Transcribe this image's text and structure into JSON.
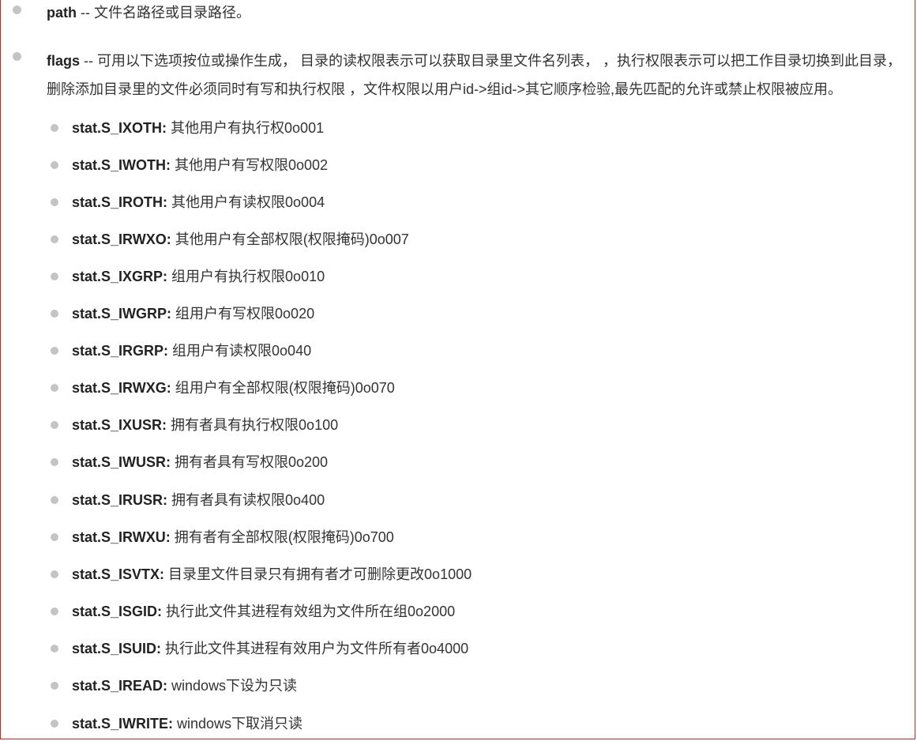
{
  "params": [
    {
      "name": "path",
      "separator": " -- ",
      "text": "文件名路径或目录路径。"
    },
    {
      "name": "flags",
      "separator": " -- ",
      "text": "可用以下选项按位或操作生成， 目录的读权限表示可以获取目录里文件名列表， ，执行权限表示可以把工作目录切换到此目录， 删除添加目录里的文件必须同时有写和执行权限 ，文件权限以用户id->组id->其它顺序检验,最先匹配的允许或禁止权限被应用。"
    }
  ],
  "flags": [
    {
      "name": "stat.S_IXOTH:",
      "desc": " 其他用户有执行权0o001"
    },
    {
      "name": "stat.S_IWOTH:",
      "desc": " 其他用户有写权限0o002"
    },
    {
      "name": "stat.S_IROTH:",
      "desc": " 其他用户有读权限0o004"
    },
    {
      "name": "stat.S_IRWXO:",
      "desc": " 其他用户有全部权限(权限掩码)0o007"
    },
    {
      "name": "stat.S_IXGRP:",
      "desc": " 组用户有执行权限0o010"
    },
    {
      "name": "stat.S_IWGRP:",
      "desc": " 组用户有写权限0o020"
    },
    {
      "name": "stat.S_IRGRP:",
      "desc": " 组用户有读权限0o040"
    },
    {
      "name": "stat.S_IRWXG:",
      "desc": " 组用户有全部权限(权限掩码)0o070"
    },
    {
      "name": "stat.S_IXUSR:",
      "desc": " 拥有者具有执行权限0o100"
    },
    {
      "name": "stat.S_IWUSR:",
      "desc": " 拥有者具有写权限0o200"
    },
    {
      "name": "stat.S_IRUSR:",
      "desc": " 拥有者具有读权限0o400"
    },
    {
      "name": "stat.S_IRWXU:",
      "desc": " 拥有者有全部权限(权限掩码)0o700"
    },
    {
      "name": "stat.S_ISVTX:",
      "desc": " 目录里文件目录只有拥有者才可删除更改0o1000"
    },
    {
      "name": "stat.S_ISGID:",
      "desc": " 执行此文件其进程有效组为文件所在组0o2000"
    },
    {
      "name": "stat.S_ISUID:",
      "desc": " 执行此文件其进程有效用户为文件所有者0o4000"
    },
    {
      "name": "stat.S_IREAD:",
      "desc": " windows下设为只读"
    },
    {
      "name": "stat.S_IWRITE:",
      "desc": " windows下取消只读"
    }
  ]
}
